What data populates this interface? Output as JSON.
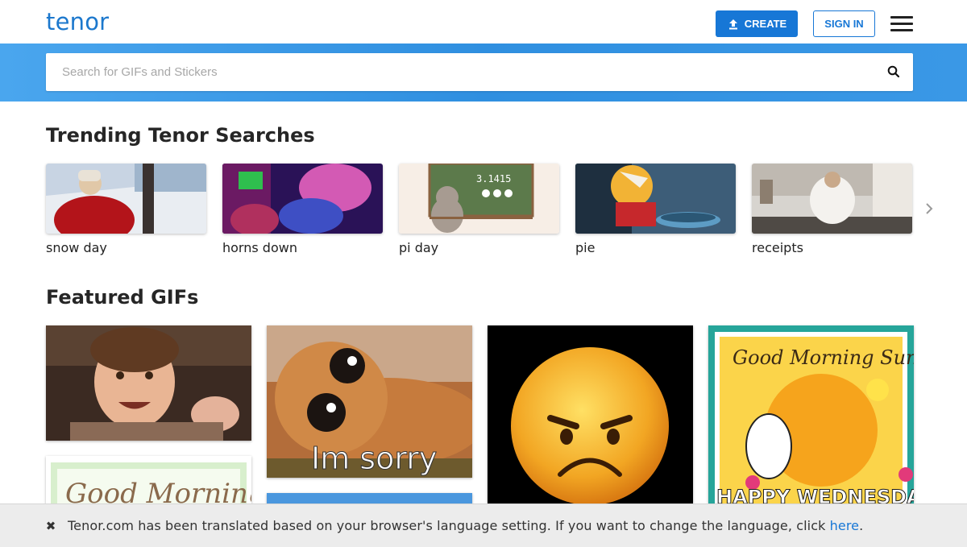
{
  "header": {
    "logo": "tenor",
    "create_label": "CREATE",
    "signin_label": "SIGN IN"
  },
  "search": {
    "placeholder": "Search for GIFs and Stickers"
  },
  "trending": {
    "title": "Trending Tenor Searches",
    "items": [
      {
        "label": "snow day"
      },
      {
        "label": "horns down"
      },
      {
        "label": "pi day",
        "chalk_text": "3.1415"
      },
      {
        "label": "pie"
      },
      {
        "label": "receipts"
      }
    ]
  },
  "featured": {
    "title": "Featured GIFs",
    "gifs": [
      {
        "caption": ""
      },
      {
        "caption": "Good Morning"
      },
      {
        "caption": "Im sorry"
      },
      {
        "caption": ""
      },
      {
        "caption": ""
      },
      {
        "caption": "Good Morning Sunshine",
        "caption2": "HAPPY WEDNESDAY!"
      }
    ]
  },
  "banner": {
    "text": "Tenor.com has been translated based on your browser's language setting. If you want to change the language, click ",
    "link": "here",
    "suffix": "."
  },
  "colors": {
    "brand": "#1c78cd",
    "accent": "#1777d6",
    "search_band": "#3a98e6"
  }
}
